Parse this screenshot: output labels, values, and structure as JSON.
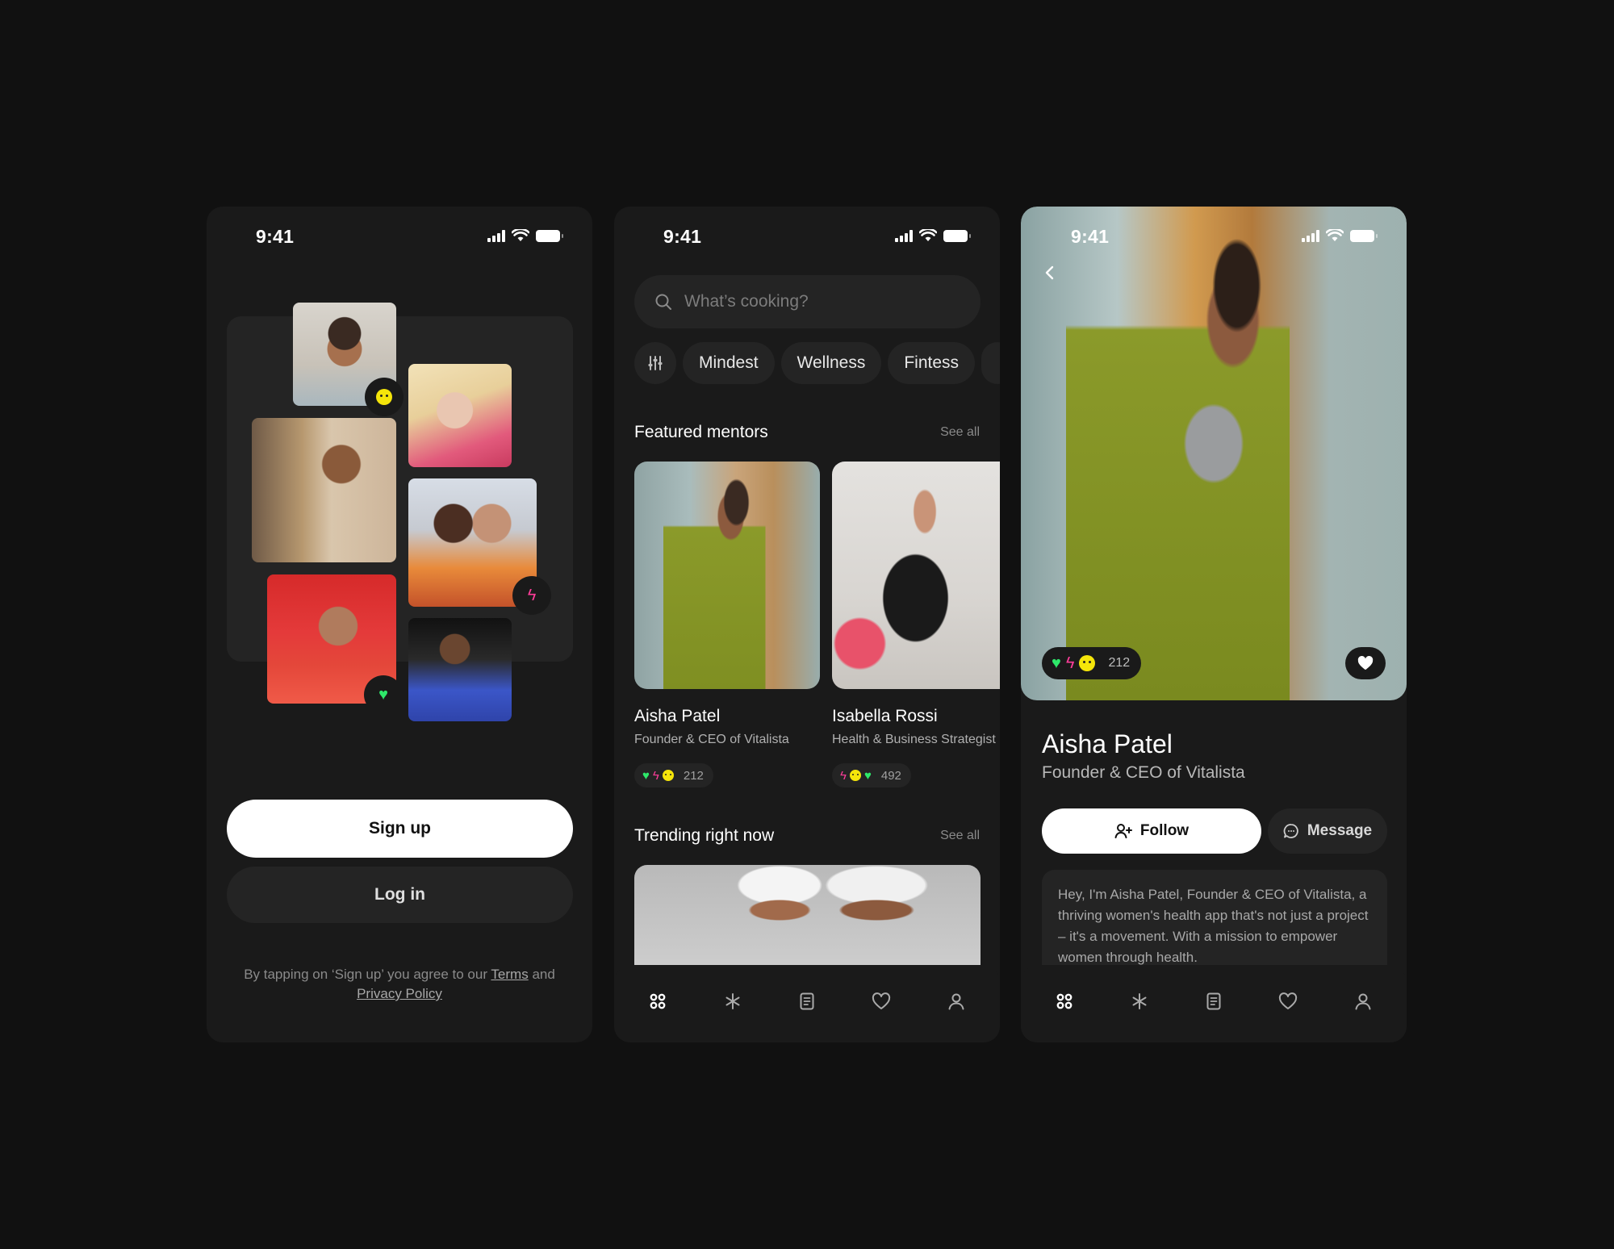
{
  "status": {
    "time": "9:41"
  },
  "onboarding": {
    "signup_label": "Sign up",
    "login_label": "Log in",
    "terms_prefix": "By tapping on ‘Sign up’ you agree to our",
    "terms_link": "Terms",
    "terms_and": "and",
    "privacy_link": "Privacy Policy"
  },
  "discover": {
    "search_placeholder": "What’s cooking?",
    "chips": [
      "Mindest",
      "Wellness",
      "Fintess"
    ],
    "featured": {
      "title": "Featured mentors",
      "see_all": "See all",
      "mentors": [
        {
          "name": "Aisha Patel",
          "role": "Founder & CEO of Vitalista",
          "count": "212",
          "reactions": [
            "heart",
            "bolt",
            "smile"
          ]
        },
        {
          "name": "Isabella Rossi",
          "role": "Health & Business Strategist",
          "count": "492",
          "reactions": [
            "bolt",
            "smile",
            "heart"
          ]
        }
      ]
    },
    "trending": {
      "title": "Trending right now",
      "see_all": "See all"
    }
  },
  "profile": {
    "reaction_count": "212",
    "name": "Aisha Patel",
    "role": "Founder & CEO of Vitalista",
    "follow_label": "Follow",
    "message_label": "Message",
    "bio": "Hey, I'm Aisha Patel, Founder & CEO of Vitalista, a thriving women's health app that's not just a project – it's a movement. With a mission to empower women through health."
  },
  "nav": [
    "home-icon",
    "sparkle-icon",
    "notes-icon",
    "heart-icon",
    "profile-icon"
  ],
  "colors": {
    "background": "#111111",
    "surface": "#1a1a1a",
    "surface_alt": "#242424",
    "heart": "#2ee86a",
    "bolt": "#ff3d9a",
    "smile": "#f5e50a"
  }
}
